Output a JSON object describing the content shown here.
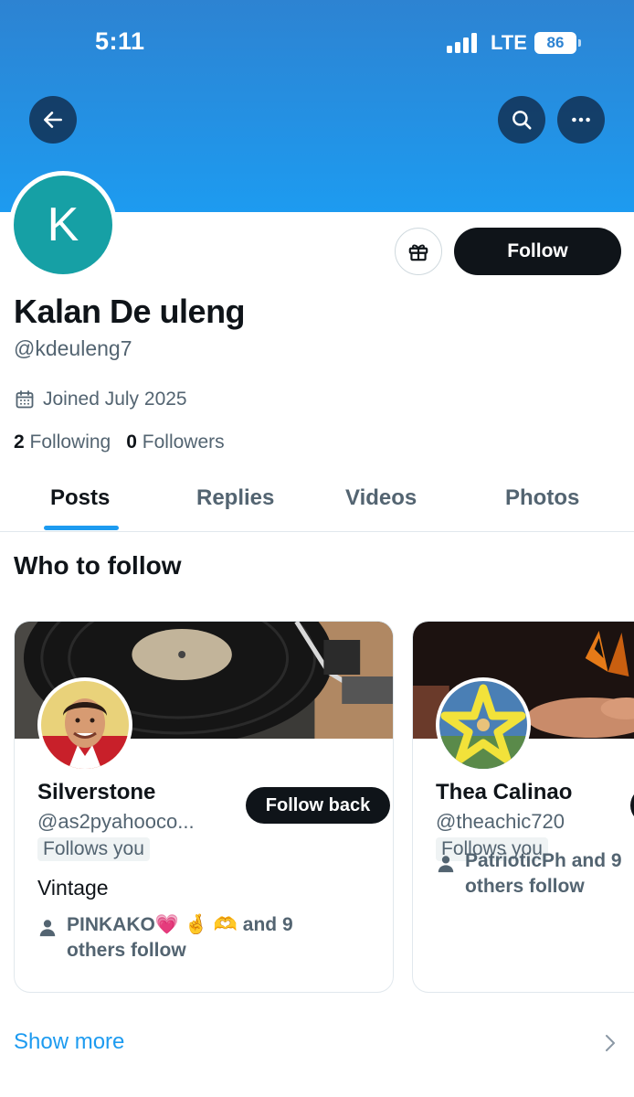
{
  "status_bar": {
    "time": "5:11",
    "network": "LTE",
    "battery": "86"
  },
  "profile": {
    "avatar_letter": "K",
    "avatar_color": "#16a0a5",
    "display_name": "Kalan De uleng",
    "handle": "@kdeuleng7",
    "joined": "Joined July 2025",
    "following_count": "2",
    "following_label": "Following",
    "followers_count": "0",
    "followers_label": "Followers",
    "follow_label": "Follow"
  },
  "tabs": [
    {
      "label": "Posts",
      "active": true
    },
    {
      "label": "Replies",
      "active": false
    },
    {
      "label": "Videos",
      "active": false
    },
    {
      "label": "Photos",
      "active": false
    }
  ],
  "who_to_follow": {
    "title": "Who to follow",
    "cards": [
      {
        "name": "Silverstone",
        "handle": "@as2pyahooco...",
        "badge": "Follows you",
        "bio": "Vintage",
        "social_line1": "PINKAKO💗 🤞 🫶 and 9",
        "social_line2": "others follow",
        "button": "Follow back"
      },
      {
        "name": "Thea Calinao",
        "handle": "@theachic720",
        "badge": "Follows you",
        "social_line1": "PatrioticPh and 9",
        "social_line2": "others follow"
      }
    ],
    "show_more": "Show more"
  },
  "colors": {
    "accent": "#1d9bf0",
    "banner_top": "#2d83d2",
    "primary_text": "#0f1419",
    "secondary_text": "#536471"
  }
}
